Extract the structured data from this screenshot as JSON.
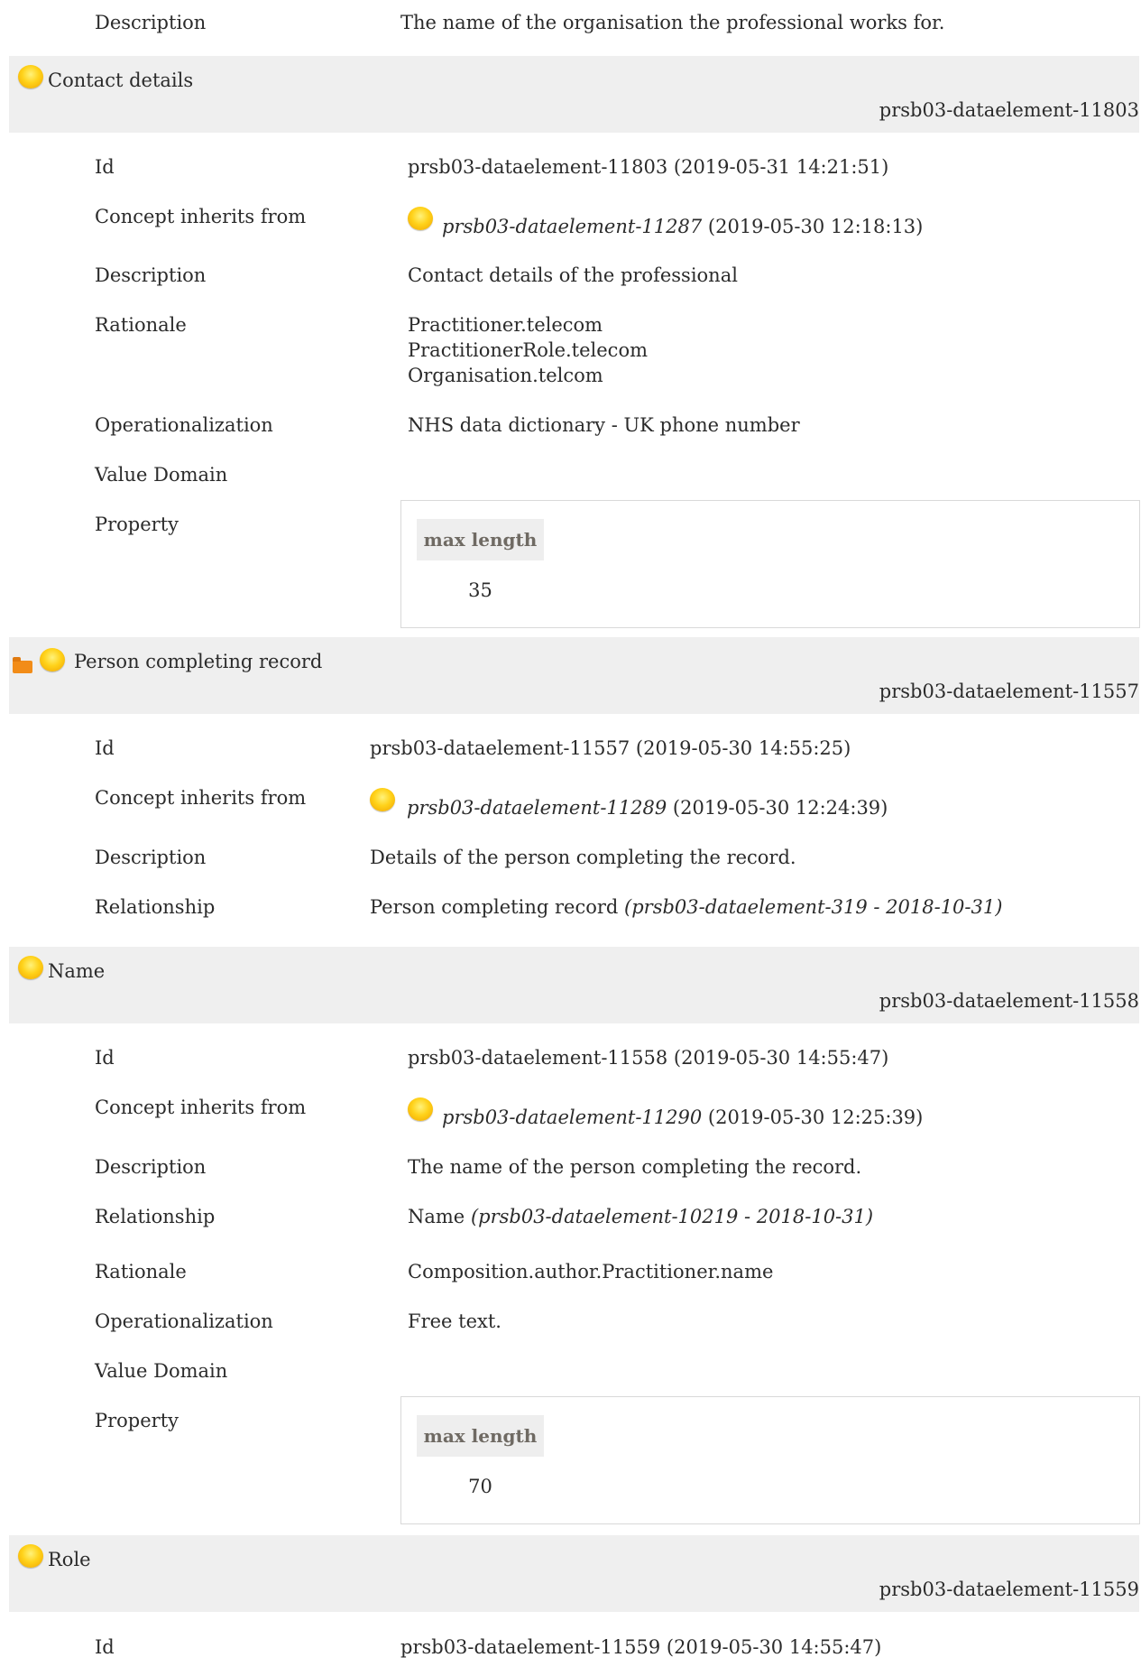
{
  "top_row": {
    "label": "Description",
    "value": "The name of the organisation the professional works for."
  },
  "labels": {
    "id": "Id",
    "inherits": "Concept inherits from",
    "description": "Description",
    "rationale": "Rationale",
    "operationalization": "Operationalization",
    "value_domain": "Value Domain",
    "property": "Property",
    "relationship": "Relationship",
    "max_length": "max length"
  },
  "contact": {
    "title": "Contact details",
    "code": "prsb03-dataelement-11803",
    "id": "prsb03-dataelement-11803 (2019-05-31 14:21:51)",
    "inherit_link": "prsb03-dataelement-11287",
    "inherit_date": "(2019-05-30 12:18:13)",
    "description": "Contact details of the professional",
    "rationale": [
      "Practitioner.telecom",
      "PractitionerRole.telecom",
      "Organisation.telcom"
    ],
    "operationalization": "NHS data dictionary - UK phone number",
    "max_length": "35"
  },
  "person": {
    "title": "Person completing record",
    "code": "prsb03-dataelement-11557",
    "id": "prsb03-dataelement-11557 (2019-05-30 14:55:25)",
    "inherit_link": "prsb03-dataelement-11289",
    "inherit_date": "(2019-05-30 12:24:39)",
    "description": "Details of the person completing the record.",
    "relationship_text": "Person completing record",
    "relationship_ref": "(prsb03-dataelement-319 - 2018-10-31)"
  },
  "name": {
    "title": "Name",
    "code": "prsb03-dataelement-11558",
    "id": "prsb03-dataelement-11558 (2019-05-30 14:55:47)",
    "inherit_link": "prsb03-dataelement-11290",
    "inherit_date": "(2019-05-30 12:25:39)",
    "description": "The name of the person completing the record.",
    "relationship_text": "Name",
    "relationship_ref": "(prsb03-dataelement-10219 - 2018-10-31)",
    "rationale": "Composition.author.Practitioner.name",
    "operationalization": "Free text.",
    "max_length": "70"
  },
  "role": {
    "title": "Role",
    "code": "prsb03-dataelement-11559",
    "id": "prsb03-dataelement-11559 (2019-05-30 14:55:47)"
  }
}
